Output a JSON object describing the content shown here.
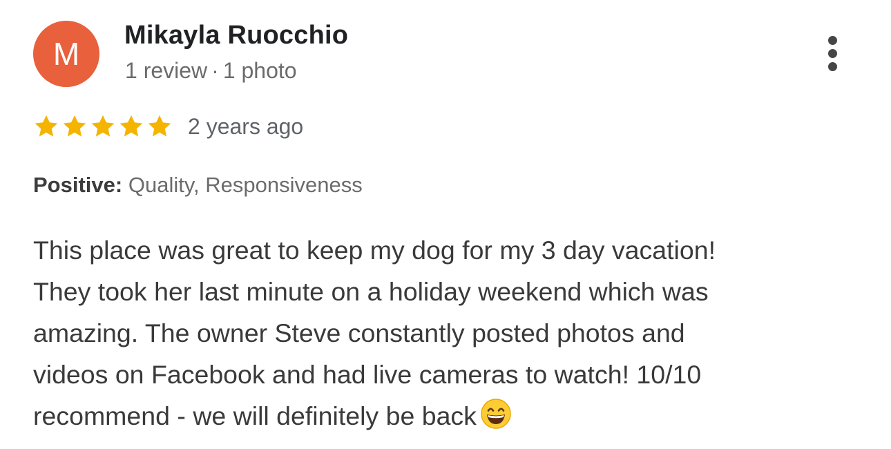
{
  "reviewer": {
    "initial": "M",
    "name": "Mikayla Ruocchio",
    "reviews": "1 review",
    "separator": "·",
    "photos": "1 photo",
    "avatar_color": "#e8603c"
  },
  "menu": {
    "icon": "more-vert-icon"
  },
  "rating": {
    "stars": 5,
    "max_stars": 5,
    "star_color": "#f4b400",
    "date": "2 years ago"
  },
  "highlights": {
    "label": "Positive:",
    "values": "Quality, Responsiveness"
  },
  "review": {
    "lines": [
      "This place was great to keep my dog for my 3 day vacation!",
      "They took her last minute on a holiday weekend which was",
      "amazing. The owner Steve constantly posted photos and",
      "videos on Facebook and had live cameras to watch! 10/10",
      "recommend - we will definitely be back"
    ],
    "emoji": "grinning-face-with-smiling-eyes-icon"
  }
}
